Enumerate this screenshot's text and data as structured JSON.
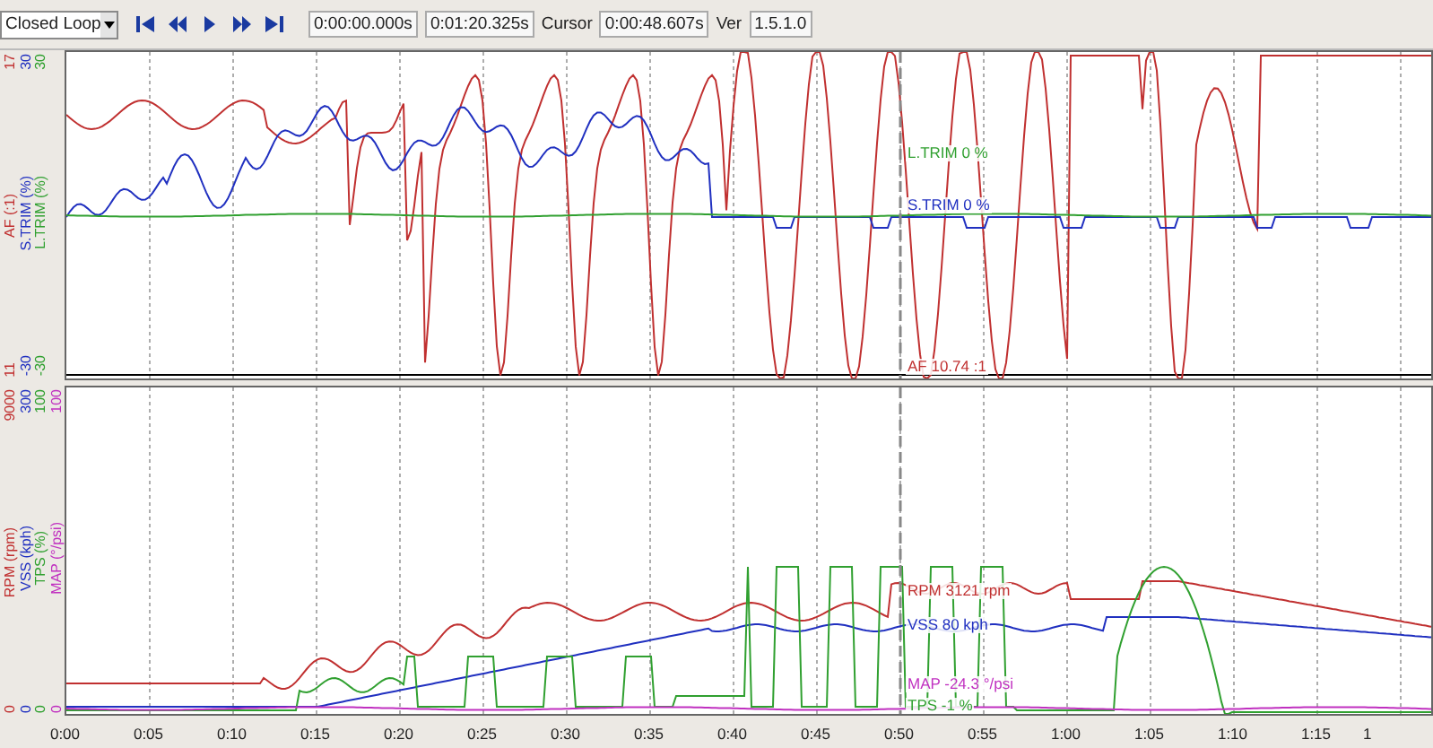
{
  "toolbar": {
    "mode_dropdown": {
      "value": "Closed Loop"
    },
    "start_time": "0:00:00.000s",
    "end_time": "0:01:20.325s",
    "cursor_label": "Cursor",
    "cursor_time": "0:00:48.607s",
    "version_label": "Ver",
    "version": "1.5.1.0"
  },
  "panels": [
    {
      "traces": [
        {
          "label": "AF (:1)",
          "axis_max": "17",
          "axis_min": "11",
          "color": "#c03030"
        },
        {
          "label": "S.TRIM (%)",
          "axis_max": "30",
          "axis_min": "-30",
          "color": "#2030c0"
        },
        {
          "label": "L.TRIM (%)",
          "axis_max": "30",
          "axis_min": "-30",
          "color": "#30a030"
        }
      ],
      "cursor_readings": [
        {
          "text": "L.TRIM 0 %",
          "color": "#30a030"
        },
        {
          "text": "S.TRIM 0 %",
          "color": "#2030c0"
        },
        {
          "text": "AF 10.74 :1",
          "color": "#c03030"
        }
      ]
    },
    {
      "traces": [
        {
          "label": "RPM (rpm)",
          "axis_max": "9000",
          "axis_min": "0",
          "color": "#c03030"
        },
        {
          "label": "VSS (kph)",
          "axis_max": "300",
          "axis_min": "0",
          "color": "#2030c0"
        },
        {
          "label": "TPS (%)",
          "axis_max": "100",
          "axis_min": "0",
          "color": "#30a030"
        },
        {
          "label": "MAP (°/psi)",
          "axis_max": "100",
          "axis_min": "0",
          "color": "#c030c0"
        }
      ],
      "cursor_readings": [
        {
          "text": "RPM 3121 rpm",
          "color": "#c03030"
        },
        {
          "text": "VSS 80 kph",
          "color": "#2030c0"
        },
        {
          "text": "MAP -24.3 °/psi",
          "color": "#c030c0"
        },
        {
          "text": "TPS -1 %",
          "color": "#30a030"
        }
      ]
    }
  ],
  "time_axis": [
    "0:00",
    "0:05",
    "0:10",
    "0:15",
    "0:20",
    "0:25",
    "0:30",
    "0:35",
    "0:40",
    "0:45",
    "0:50",
    "0:55",
    "1:00",
    "1:05",
    "1:10",
    "1:15",
    "1"
  ]
}
